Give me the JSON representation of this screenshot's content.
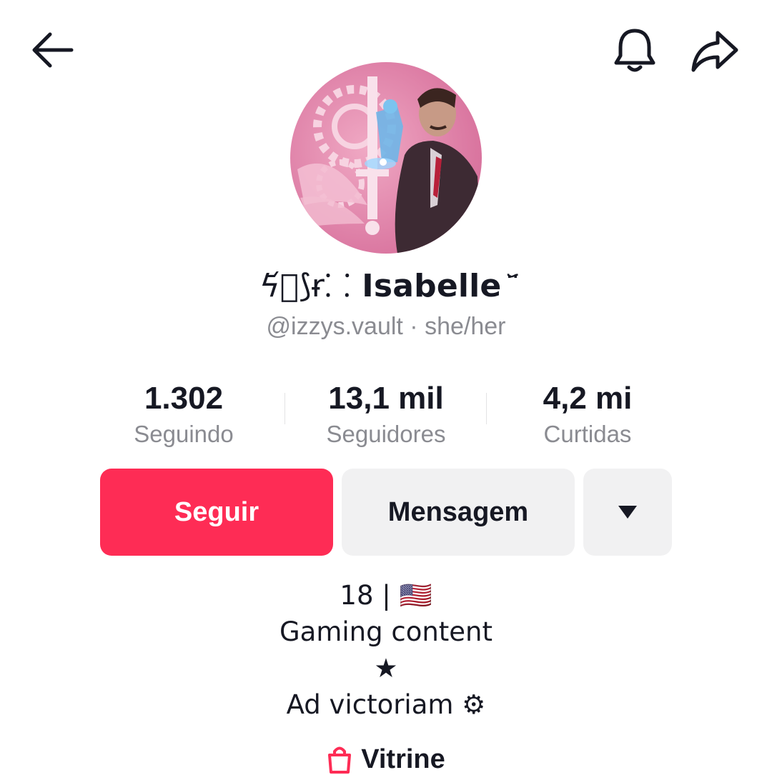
{
  "topbar": {
    "back_icon": "arrow-left-icon",
    "bell_icon": "bell-icon",
    "share_icon": "share-arrow-icon"
  },
  "profile": {
    "display_name_prefix": "ϟ᷄ᷤ⟆ɍ⸬",
    "display_name": "Isabelle",
    "display_name_suffix": "᷃̈",
    "handle": "@izzys.vault · she/her"
  },
  "stats": [
    {
      "value": "1.302",
      "label": "Seguindo"
    },
    {
      "value": "13,1 mil",
      "label": "Seguidores"
    },
    {
      "value": "4,2 mi",
      "label": "Curtidas"
    }
  ],
  "actions": {
    "follow_label": "Seguir",
    "message_label": "Mensagem",
    "more_icon": "caret-down-icon"
  },
  "bio": {
    "line1": "18 | 🇺🇸",
    "line2": "Gaming content",
    "line3": "★",
    "line4": "Ad victoriam ⚙"
  },
  "shop": {
    "label": "Vitrine",
    "icon": "shopping-bag-icon"
  },
  "colors": {
    "accent": "#fe2c55",
    "secondary_button": "#f1f1f2",
    "muted_text": "#8a8b91",
    "avatar_tint": "#e48fb0"
  }
}
